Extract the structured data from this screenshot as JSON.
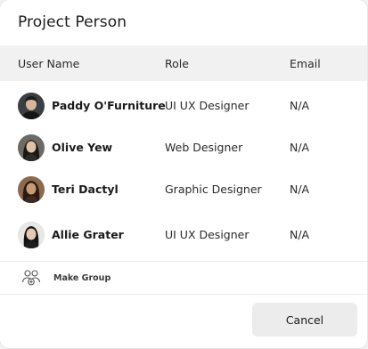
{
  "dialog": {
    "title": "Project Person"
  },
  "table": {
    "headers": [
      "User Name",
      "Role",
      "Email"
    ],
    "rows": [
      {
        "name": "Paddy O'Furniture",
        "role": "UI UX Designer",
        "email": "N/A"
      },
      {
        "name": "Olive Yew",
        "role": "Web Designer",
        "email": "N/A"
      },
      {
        "name": "Teri Dactyl",
        "role": "Graphic Designer",
        "email": "N/A"
      },
      {
        "name": "Allie Grater",
        "role": "UI UX Designer",
        "email": "N/A"
      }
    ]
  },
  "actions": {
    "make_group_label": "Make Group",
    "make_group_icon": "users-group-add-icon",
    "cancel_label": "Cancel"
  }
}
